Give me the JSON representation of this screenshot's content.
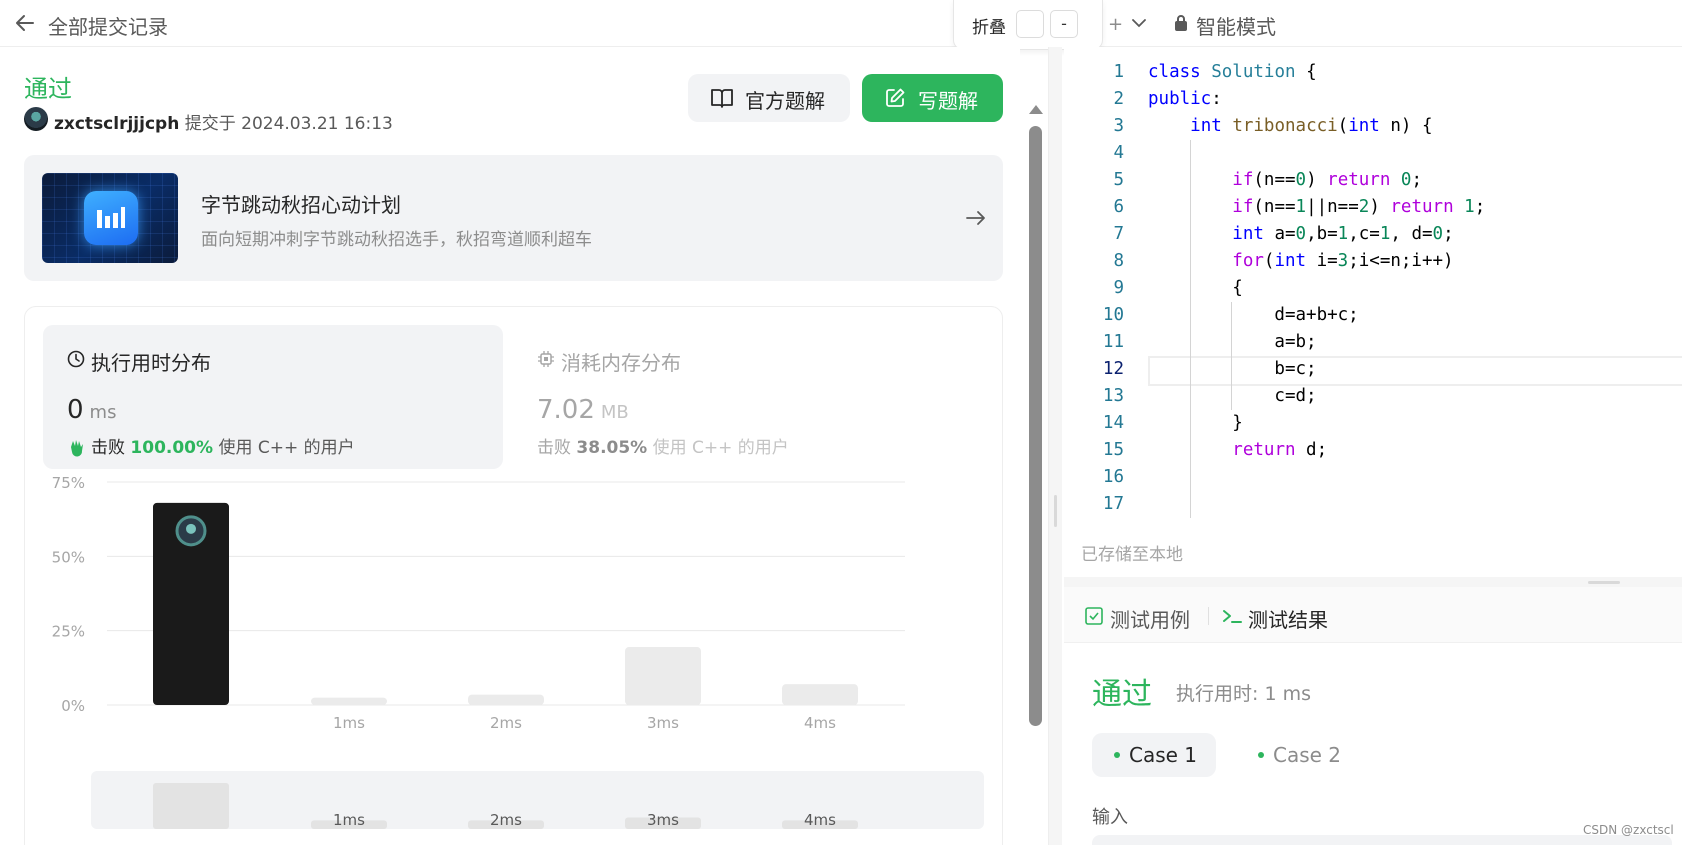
{
  "header": {
    "back_label": "全部提交记录",
    "fold_label": "折叠",
    "fold_minus": "-",
    "plus_label": "+",
    "mode_label": "智能模式"
  },
  "submission": {
    "status": "通过",
    "username": "zxctsclrjjjcph",
    "submitted_prefix": "提交于",
    "submitted_time": "2024.03.21 16:13",
    "official_solution_label": "官方题解",
    "write_solution_label": "写题解"
  },
  "promo": {
    "title": "字节跳动秋招心动计划",
    "subtitle": "面向短期冲刺字节跳动秋招选手，秋招弯道顺利超车"
  },
  "runtime": {
    "title": "执行用时分布",
    "value": "0",
    "unit": "ms",
    "beat_prefix": "击败",
    "beat_pct": "100.00%",
    "beat_suffix": "使用 C++ 的用户"
  },
  "memory": {
    "title": "消耗内存分布",
    "value": "7.02",
    "unit": "MB",
    "beat_prefix": "击败",
    "beat_pct": "38.05%",
    "beat_suffix": "使用 C++ 的用户"
  },
  "chart_data": {
    "type": "bar",
    "title": "",
    "xlabel": "",
    "ylabel": "",
    "ylim": [
      0,
      75
    ],
    "y_ticks": [
      "75%",
      "50%",
      "25%",
      "0%"
    ],
    "x_tick_labels": [
      "1ms",
      "2ms",
      "3ms",
      "4ms"
    ],
    "categories": [
      "0ms",
      "1ms",
      "2ms",
      "3ms",
      "4ms"
    ],
    "values": [
      68,
      2.5,
      3.5,
      19.5,
      7
    ],
    "highlight_index": 0,
    "colors": {
      "highlight": "#1a1a1a",
      "bar": "#ebebeb",
      "grid": "#e8e8e8",
      "axis_text": "#a6a6a6"
    },
    "mini_values": [
      16,
      3,
      3,
      4,
      3
    ],
    "mini_tick_labels": [
      "1ms",
      "2ms",
      "3ms",
      "4ms"
    ]
  },
  "editor": {
    "active_line": 12,
    "lines": [
      "class Solution {",
      "public:",
      "    int tribonacci(int n) {",
      "",
      "        if(n==0) return 0;",
      "        if(n==1||n==2) return 1;",
      "        int a=0,b=1,c=1, d=0;",
      "        for(int i=3;i<=n;i++)",
      "        {",
      "            d=a+b+c;",
      "            a=b;",
      "            b=c;",
      "            c=d;",
      "        }",
      "        return d;",
      "",
      ""
    ],
    "saved_label": "已存储至本地"
  },
  "results": {
    "tab_testcase": "测试用例",
    "tab_result": "测试结果",
    "status": "通过",
    "runtime": "执行用时: 1 ms",
    "cases": [
      "Case 1",
      "Case 2"
    ],
    "input_label": "输入"
  },
  "watermark": "CSDN @zxctscl",
  "colors": {
    "accent": "#2db55d",
    "text": "#262626",
    "muted": "#8c8c8c"
  }
}
